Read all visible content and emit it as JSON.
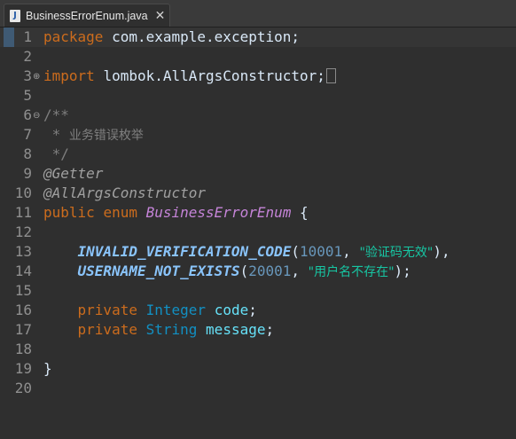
{
  "tab": {
    "icon": "java-file-icon",
    "title": "BusinessErrorEnum.java",
    "close": "✕"
  },
  "lines": [
    {
      "n": "1",
      "kw": "package",
      "rest": "com.example.exception;"
    },
    {
      "n": "2"
    },
    {
      "n": "3",
      "fold": "⊕",
      "kw": "import",
      "rest": "lombok.AllArgsConstructor;"
    },
    {
      "n": "5"
    },
    {
      "n": "6",
      "fold": "⊖",
      "text": "/**"
    },
    {
      "n": "7",
      "text": " *",
      "cjk": "业务错误枚举"
    },
    {
      "n": "8",
      "text": " */"
    },
    {
      "n": "9",
      "text": "@Getter"
    },
    {
      "n": "10",
      "text": "@AllArgsConstructor"
    },
    {
      "n": "11",
      "kw1": "public",
      "kw2": "enum",
      "cls": "BusinessErrorEnum",
      "rest": "{"
    },
    {
      "n": "12"
    },
    {
      "n": "13",
      "const": "INVALID_VERIFICATION_CODE",
      "open": "(",
      "num": "10001",
      "sep": ", ",
      "str": "\"验证码无效\"",
      "close": "),"
    },
    {
      "n": "14"
    },
    {
      "n": "15",
      "const": "USERNAME_NOT_EXISTS",
      "open": "(",
      "num": "20001",
      "sep": ", ",
      "str": "\"用户名不存在\"",
      "close": ");"
    },
    {
      "n": "15"
    },
    {
      "n": "16",
      "kw": "private",
      "typ": "Integer",
      "fld": "code",
      "end": ";"
    },
    {
      "n": "17",
      "kw": "private",
      "typ": "String",
      "fld": "message",
      "end": ";"
    },
    {
      "n": "18"
    },
    {
      "n": "19",
      "text": "}"
    },
    {
      "n": "20"
    }
  ]
}
